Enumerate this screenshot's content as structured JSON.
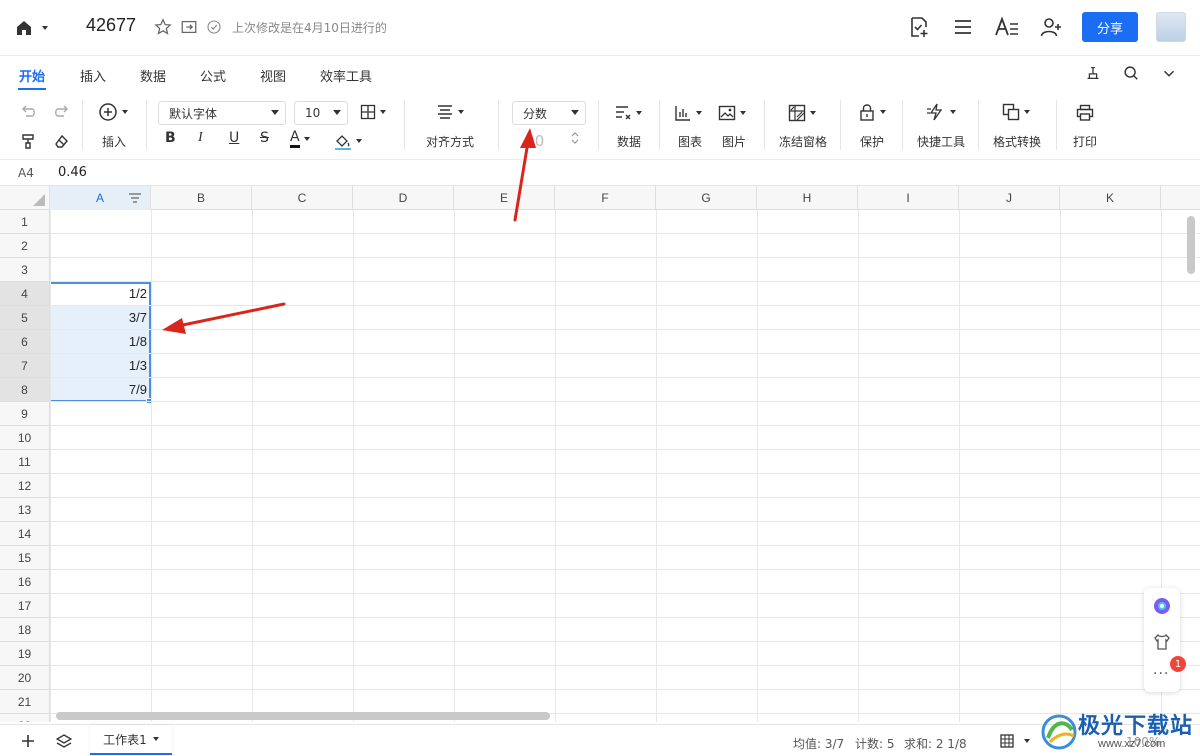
{
  "titlebar": {
    "doc_title": "42677",
    "last_modified": "上次修改是在4月10日进行的",
    "share_label": "分享"
  },
  "tabs": [
    {
      "label": "开始",
      "active": true
    },
    {
      "label": "插入"
    },
    {
      "label": "数据"
    },
    {
      "label": "公式"
    },
    {
      "label": "视图"
    },
    {
      "label": "效率工具"
    }
  ],
  "toolbar": {
    "insert_label": "插入",
    "font_name": "默认字体",
    "font_size": "10",
    "bold": "B",
    "italic": "I",
    "underline": "U",
    "strike": "S",
    "font_color": "A",
    "align_label": "对齐方式",
    "number_format": "分数",
    "decimal_hint": ".0",
    "data_label": "数据",
    "chart_label": "图表",
    "picture_label": "图片",
    "freeze_label": "冻结窗格",
    "protect_label": "保护",
    "quick_tools_label": "快捷工具",
    "format_convert_label": "格式转换",
    "print_label": "打印"
  },
  "formula_bar": {
    "cell_ref": "A4",
    "value": "0.46"
  },
  "grid": {
    "columns": [
      "A",
      "B",
      "C",
      "D",
      "E",
      "F",
      "G",
      "H",
      "I",
      "J",
      "K"
    ],
    "rows": [
      "1",
      "2",
      "3",
      "4",
      "5",
      "6",
      "7",
      "8",
      "9",
      "10",
      "11",
      "12",
      "13",
      "14",
      "15",
      "16",
      "17",
      "18",
      "19",
      "20",
      "21",
      "22"
    ],
    "cells": [
      {
        "ref": "A4",
        "value": "1/2"
      },
      {
        "ref": "A5",
        "value": "3/7"
      },
      {
        "ref": "A6",
        "value": "1/8"
      },
      {
        "ref": "A7",
        "value": "1/3"
      },
      {
        "ref": "A8",
        "value": "7/9"
      }
    ]
  },
  "side_panel": {
    "badge_count": "1"
  },
  "bottom": {
    "sheet_name": "工作表1",
    "avg": "均值: 3/7",
    "count": "计数: 5",
    "sum": "求和: 2 1/8",
    "zoom": "100%"
  },
  "watermark": {
    "text": "极光下载站",
    "url": "www.xz7.com"
  },
  "colors": {
    "accent": "#1b6ef3",
    "selection": "#4a8fe0",
    "annotation_arrow": "#d9261c"
  }
}
